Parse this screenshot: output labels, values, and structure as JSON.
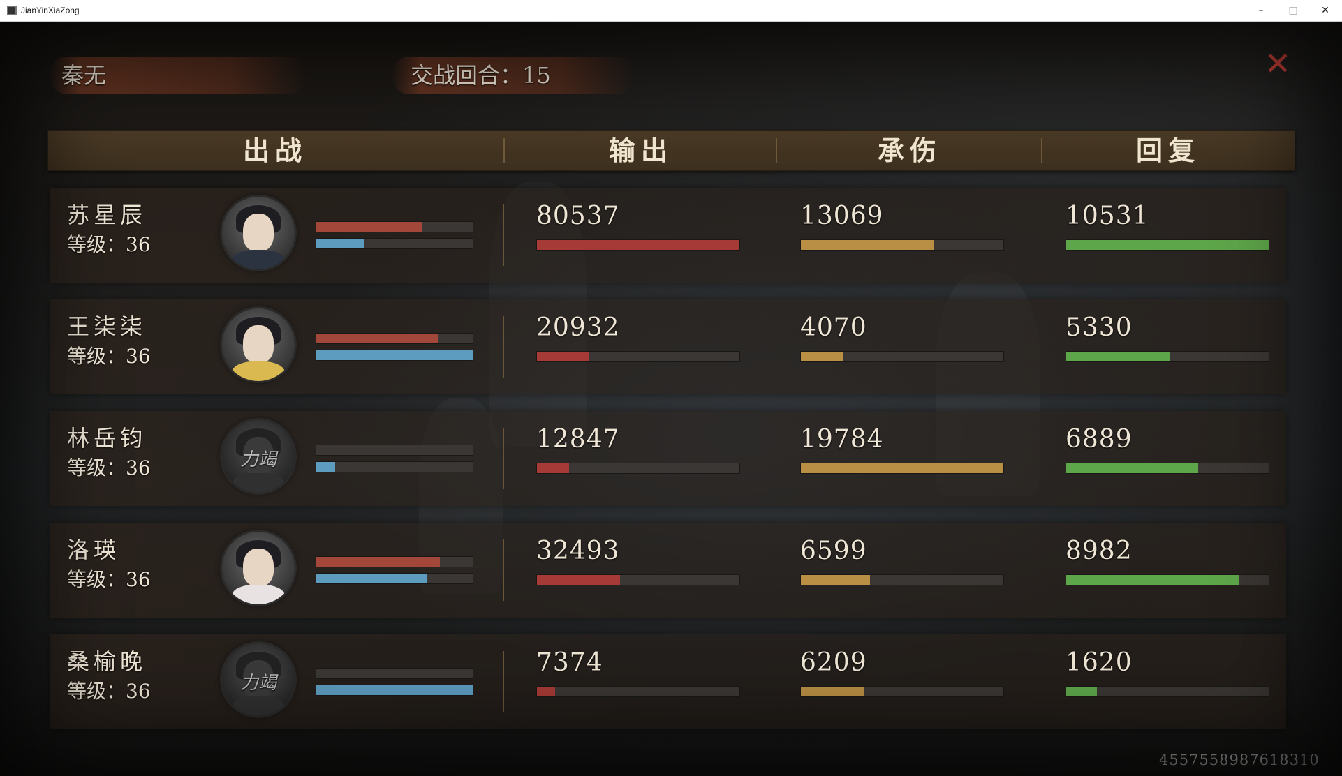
{
  "window": {
    "title": "JianYinXiaZong",
    "min": "–",
    "max": "□",
    "close": "✕"
  },
  "top": {
    "player_name": "秦无",
    "rounds_text": "交战回合：15",
    "close_glyph": "✕"
  },
  "columns": {
    "deploy": "出战",
    "output": "输出",
    "damage_taken": "承伤",
    "healing": "回复"
  },
  "members": [
    {
      "name": "苏星辰",
      "level": "等级：36",
      "avatar": "portrait-icon",
      "status": "",
      "hp": 0.68,
      "mp": 0.31,
      "output": "80537",
      "output_frac": 1.0,
      "taken": "13069",
      "taken_frac": 0.66,
      "heal": "10531",
      "heal_frac": 1.0
    },
    {
      "name": "王柒柒",
      "level": "等级：36",
      "avatar": "portrait-icon",
      "status": "",
      "hp": 0.78,
      "mp": 1.0,
      "output": "20932",
      "output_frac": 0.26,
      "taken": "4070",
      "taken_frac": 0.21,
      "heal": "5330",
      "heal_frac": 0.51
    },
    {
      "name": "林岳钧",
      "level": "等级：36",
      "avatar": "portrait-icon",
      "status": "力竭",
      "hp": 0.0,
      "mp": 0.12,
      "output": "12847",
      "output_frac": 0.16,
      "taken": "19784",
      "taken_frac": 1.0,
      "heal": "6889",
      "heal_frac": 0.65
    },
    {
      "name": "洛瑛",
      "level": "等级：36",
      "avatar": "portrait-icon",
      "status": "",
      "hp": 0.79,
      "mp": 0.71,
      "output": "32493",
      "output_frac": 0.41,
      "taken": "6599",
      "taken_frac": 0.34,
      "heal": "8982",
      "heal_frac": 0.85
    },
    {
      "name": "桑榆晚",
      "level": "等级：36",
      "avatar": "portrait-icon",
      "status": "力竭",
      "hp": 0.0,
      "mp": 1.0,
      "output": "7374",
      "output_frac": 0.09,
      "taken": "6209",
      "taken_frac": 0.31,
      "heal": "1620",
      "heal_frac": 0.15
    }
  ],
  "battle_id": "4557558987618310",
  "colors": {
    "output_bar": "#a63a36",
    "taken_bar": "#b88f45",
    "heal_bar": "#5ea64a",
    "hp_bar": "#a2473a",
    "mp_bar": "#5e9cbf",
    "close_x": "#d8443c"
  }
}
